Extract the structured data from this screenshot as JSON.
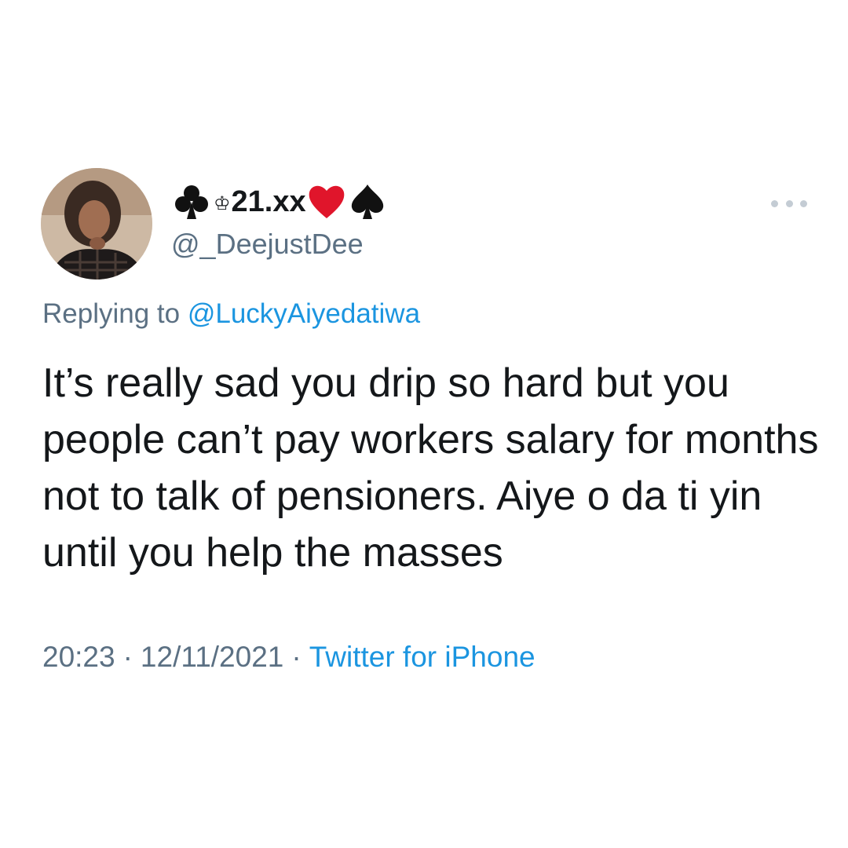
{
  "tweet": {
    "author": {
      "display_name_prefix": "♣",
      "display_name_crown": "♔",
      "display_name_text": "21.xx",
      "display_name_icons": [
        "club-icon",
        "crown-icon",
        "heart-icon",
        "spade-icon"
      ],
      "handle": "@_DeejustDee"
    },
    "more_icon": "more-horizontal-icon",
    "replying_prefix": "Replying to",
    "replying_to": "@LuckyAiyedatiwa",
    "text": "It’s really sad you drip so hard but you people can’t pay workers salary for months not to talk of pensioners. Aiye o da ti yin until you help the masses",
    "time": "20:23",
    "date": "12/11/2021",
    "separator": "·",
    "source": "Twitter for iPhone"
  },
  "colors": {
    "text_primary": "#14171a",
    "text_secondary": "#5b7083",
    "link": "#1b95e0",
    "heart": "#e0152b"
  }
}
